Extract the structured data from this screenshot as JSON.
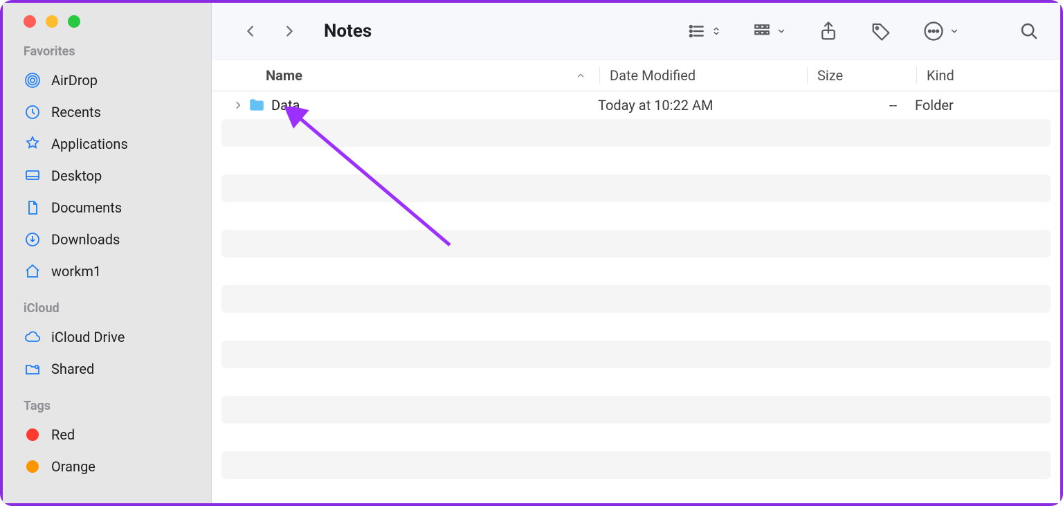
{
  "sidebar": {
    "sections": [
      {
        "heading": "Favorites",
        "items": [
          {
            "label": "AirDrop"
          },
          {
            "label": "Recents"
          },
          {
            "label": "Applications"
          },
          {
            "label": "Desktop"
          },
          {
            "label": "Documents"
          },
          {
            "label": "Downloads"
          },
          {
            "label": "workm1"
          }
        ]
      },
      {
        "heading": "iCloud",
        "items": [
          {
            "label": "iCloud Drive"
          },
          {
            "label": "Shared"
          }
        ]
      },
      {
        "heading": "Tags",
        "items": [
          {
            "label": "Red"
          },
          {
            "label": "Orange"
          }
        ]
      }
    ]
  },
  "toolbar": {
    "title": "Notes"
  },
  "columns": {
    "name": "Name",
    "date": "Date Modified",
    "size": "Size",
    "kind": "Kind"
  },
  "rows": [
    {
      "name": "Data",
      "date": "Today at 10:22 AM",
      "size": "--",
      "kind": "Folder"
    }
  ]
}
